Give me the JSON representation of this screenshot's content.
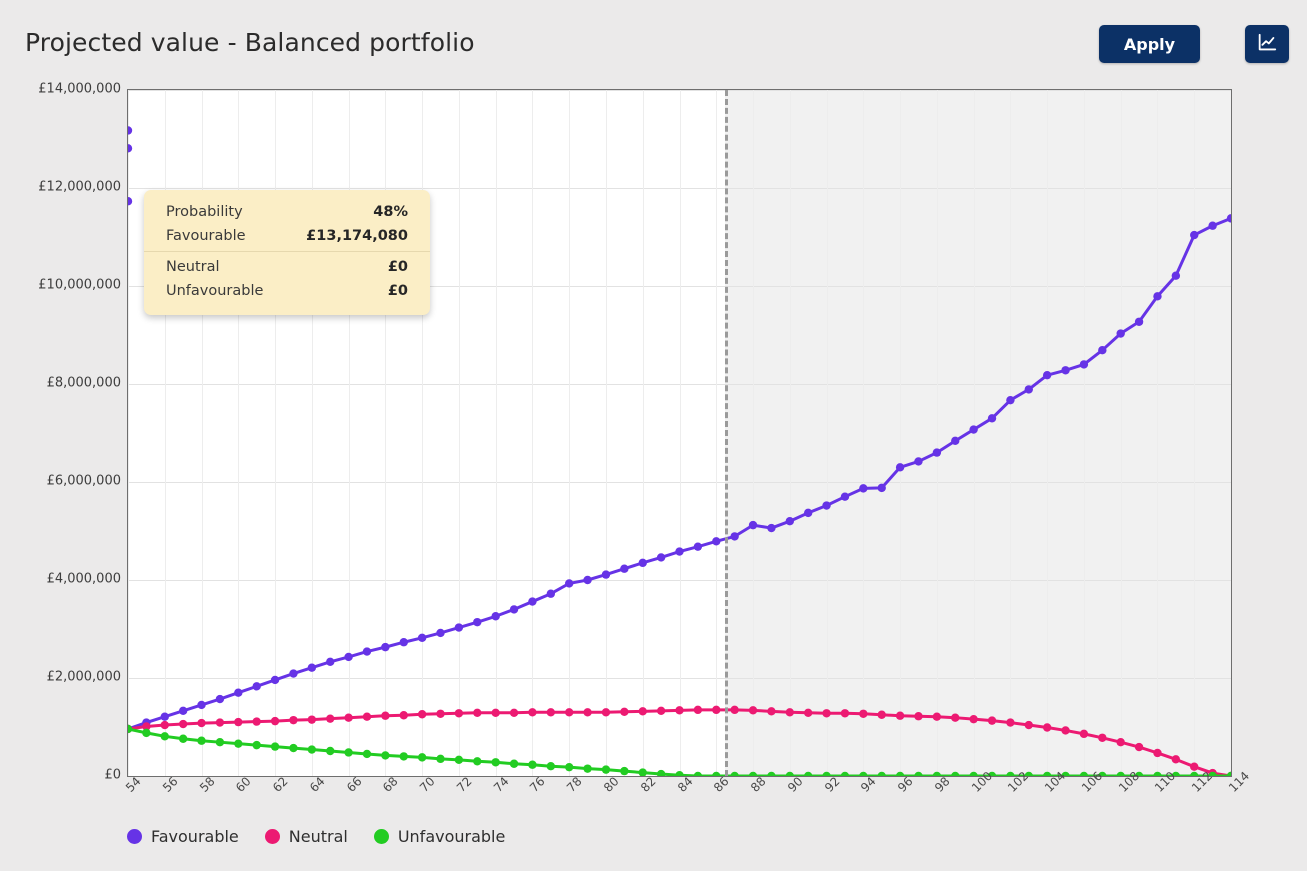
{
  "header": {
    "title": "Projected value - Balanced portfolio",
    "apply_label": "Apply",
    "chart_icon": "line-chart-icon"
  },
  "tooltip": {
    "rows": [
      {
        "label": "Probability",
        "value": "48%"
      },
      {
        "label": "Favourable",
        "value": "£13,174,080"
      },
      {
        "label": "Neutral",
        "value": "£0"
      },
      {
        "label": "Unfavourable",
        "value": "£0"
      }
    ]
  },
  "colors": {
    "favourable": "#6633e6",
    "neutral": "#ec1a72",
    "unfavourable": "#22cc22",
    "accent": "#0c3166",
    "page_background": "#ebeaea",
    "plot_background": "#ffffff",
    "projection_shade": "#f1f1f1",
    "tooltip_background": "#fbeec6",
    "divider": "#9a9a9a"
  },
  "chart_data": {
    "type": "line",
    "title": "Projected value - Balanced portfolio",
    "xlabel": "",
    "ylabel": "",
    "xlim": [
      54,
      114
    ],
    "ylim": [
      0,
      14000000
    ],
    "grid": true,
    "legend_position": "bottom-left",
    "y_ticks": [
      0,
      2000000,
      4000000,
      6000000,
      8000000,
      10000000,
      12000000,
      14000000
    ],
    "y_tick_labels": [
      "£0",
      "£2,000,000",
      "£4,000,000",
      "£6,000,000",
      "£8,000,000",
      "£10,000,000",
      "£12,000,000",
      "£14,000,000"
    ],
    "x_ticks": [
      54,
      56,
      58,
      60,
      62,
      64,
      66,
      68,
      70,
      72,
      74,
      76,
      78,
      80,
      82,
      84,
      86,
      88,
      90,
      92,
      94,
      96,
      98,
      100,
      102,
      104,
      106,
      108,
      110,
      112,
      114
    ],
    "x_tick_labels": [
      "54",
      "56",
      "58",
      "60",
      "62",
      "64",
      "66",
      "68",
      "70",
      "72",
      "74",
      "76",
      "78",
      "80",
      "82",
      "84",
      "86",
      "88",
      "90",
      "92",
      "94",
      "96",
      "98",
      "100",
      "102",
      "104",
      "106",
      "108",
      "110",
      "112",
      "114"
    ],
    "annotations": [
      {
        "type": "vertical-dashed-line",
        "x": 86.5,
        "label": ""
      },
      {
        "type": "shaded-region",
        "from": 86.5,
        "to": 114,
        "meaning": "projection"
      }
    ],
    "x": [
      54,
      55,
      56,
      57,
      58,
      59,
      60,
      61,
      62,
      63,
      64,
      65,
      66,
      67,
      68,
      69,
      70,
      71,
      72,
      73,
      74,
      75,
      76,
      77,
      78,
      79,
      80,
      81,
      82,
      83,
      84,
      85,
      86,
      87,
      88,
      89,
      90,
      91,
      92,
      93,
      94,
      95,
      96,
      97,
      98,
      99,
      100,
      101,
      102,
      103,
      104,
      105,
      106,
      107,
      108,
      109,
      110,
      111,
      112,
      113,
      114
    ],
    "series": [
      {
        "name": "Favourable",
        "color": "#6633e6",
        "values": [
          960000,
          1090000,
          1210000,
          1330000,
          1450000,
          1570000,
          1700000,
          1830000,
          1960000,
          2090000,
          2210000,
          2330000,
          2430000,
          2540000,
          2630000,
          2730000,
          2820000,
          2920000,
          3030000,
          3140000,
          3260000,
          3400000,
          3560000,
          3720000,
          3930000,
          4000000,
          4110000,
          4230000,
          4350000,
          4460000,
          4580000,
          4680000,
          4790000,
          4890000,
          5120000,
          5060000,
          5200000,
          5370000,
          5520000,
          5700000,
          5870000,
          5880000,
          6300000,
          6420000,
          6600000,
          6840000,
          7070000,
          7300000,
          7670000,
          7890000,
          8180000,
          8280000,
          8400000,
          8690000,
          9030000,
          9270000,
          9790000,
          10210000,
          11040000,
          11230000,
          11380000,
          11730000,
          12810000,
          13174080
        ]
      },
      {
        "name": "Neutral",
        "color": "#ec1a72",
        "values": [
          960000,
          1010000,
          1040000,
          1060000,
          1080000,
          1090000,
          1100000,
          1110000,
          1120000,
          1140000,
          1150000,
          1170000,
          1190000,
          1210000,
          1230000,
          1240000,
          1260000,
          1270000,
          1280000,
          1290000,
          1290000,
          1290000,
          1300000,
          1300000,
          1300000,
          1300000,
          1300000,
          1310000,
          1320000,
          1330000,
          1340000,
          1350000,
          1350000,
          1350000,
          1340000,
          1320000,
          1300000,
          1290000,
          1280000,
          1280000,
          1270000,
          1250000,
          1230000,
          1220000,
          1210000,
          1190000,
          1160000,
          1130000,
          1090000,
          1040000,
          990000,
          930000,
          860000,
          780000,
          690000,
          590000,
          470000,
          340000,
          190000,
          60000,
          0
        ]
      },
      {
        "name": "Unfavourable",
        "color": "#22cc22",
        "values": [
          960000,
          880000,
          810000,
          760000,
          720000,
          690000,
          660000,
          630000,
          600000,
          570000,
          540000,
          510000,
          480000,
          450000,
          420000,
          400000,
          380000,
          350000,
          330000,
          300000,
          280000,
          250000,
          230000,
          200000,
          180000,
          150000,
          130000,
          100000,
          70000,
          40000,
          15000,
          0,
          0,
          0,
          0,
          0,
          0,
          0,
          0,
          0,
          0,
          0,
          0,
          0,
          0,
          0,
          0,
          0,
          0,
          0,
          0,
          0,
          0,
          0,
          0,
          0,
          0,
          0,
          0,
          0,
          0
        ]
      }
    ]
  },
  "legend": [
    {
      "label": "Favourable",
      "color": "#6633e6"
    },
    {
      "label": "Neutral",
      "color": "#ec1a72"
    },
    {
      "label": "Unfavourable",
      "color": "#22cc22"
    }
  ]
}
